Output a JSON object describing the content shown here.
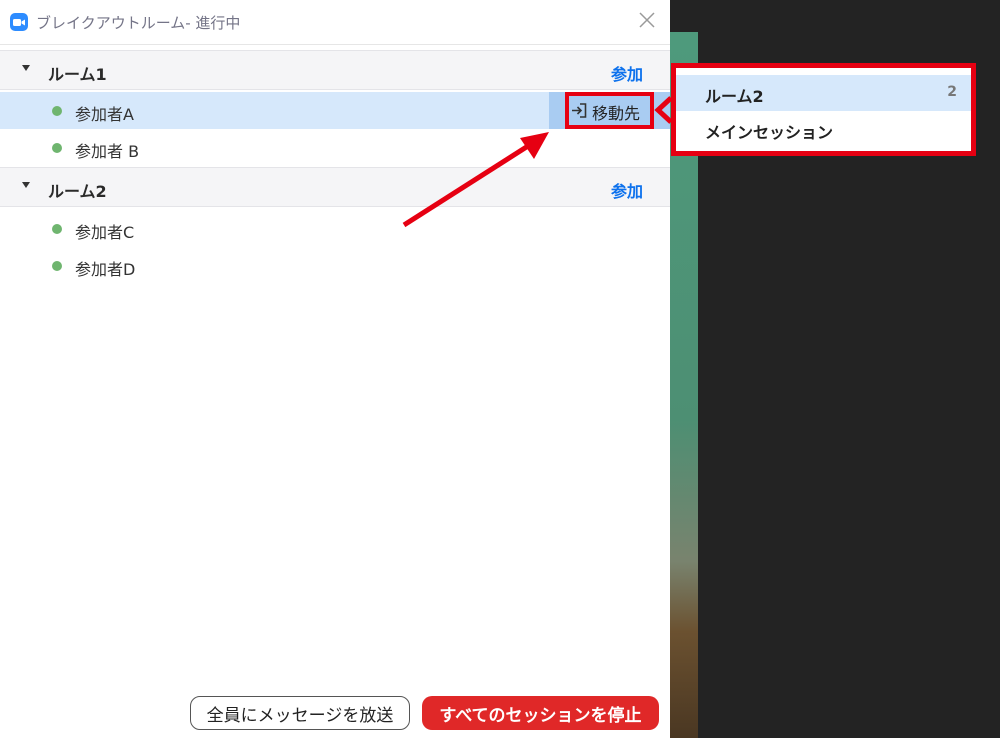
{
  "window": {
    "title": "ブレイクアウトルーム- 進行中",
    "accent": "#2d8cff"
  },
  "rooms": [
    {
      "name": "ルーム1",
      "join_label": "参加",
      "participants": [
        {
          "name": "参加者A",
          "selected": true
        },
        {
          "name": "参加者 B",
          "selected": false
        }
      ]
    },
    {
      "name": "ルーム2",
      "join_label": "参加",
      "participants": [
        {
          "name": "参加者C",
          "selected": false
        },
        {
          "name": "参加者D",
          "selected": false
        }
      ]
    }
  ],
  "move_to": {
    "label": "移動先"
  },
  "move_menu": {
    "items": [
      {
        "label": "ルーム2",
        "count": "2",
        "hovered": true
      },
      {
        "label": "メインセッション",
        "count": "",
        "hovered": false
      }
    ]
  },
  "footer": {
    "broadcast_label": "全員にメッセージを放送",
    "stop_label": "すべてのセッションを停止"
  },
  "colors": {
    "join_link": "#0e72ed",
    "highlight_red": "#e60012",
    "stop_button": "#e02828",
    "selected_row": "#d6e8fb",
    "status_dot": "#6fb56f"
  }
}
